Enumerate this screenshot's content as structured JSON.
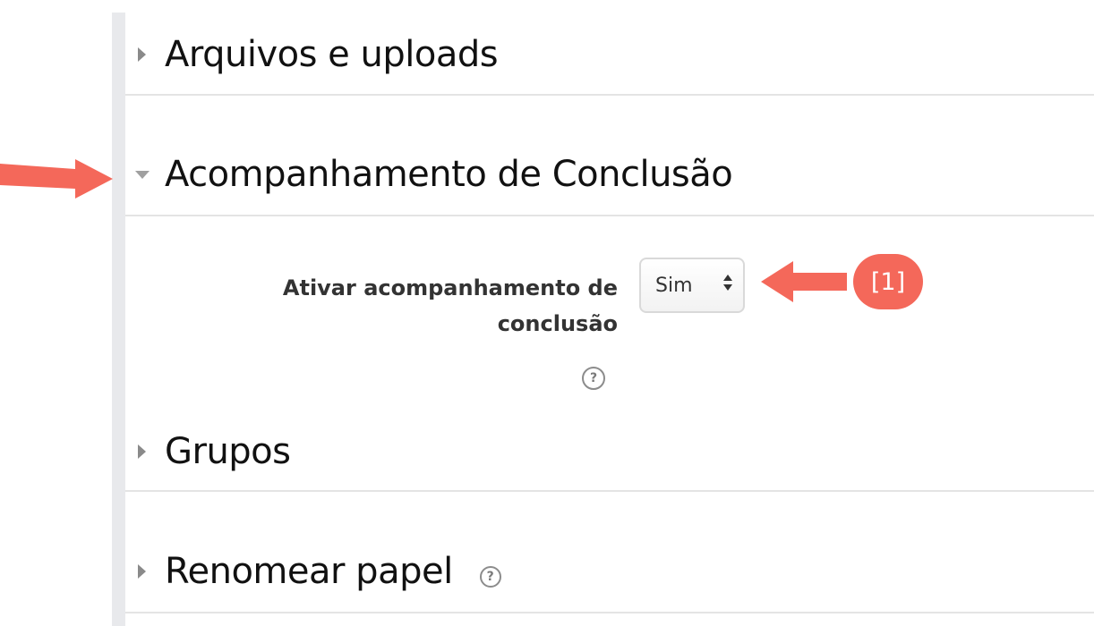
{
  "sections": [
    {
      "title": "Arquivos e uploads",
      "state": "collapsed"
    },
    {
      "title": "Acompanhamento de Conclusão",
      "state": "expanded"
    },
    {
      "title": "Grupos",
      "state": "collapsed"
    },
    {
      "title": "Renomear papel",
      "state": "collapsed"
    }
  ],
  "completion_field": {
    "label_line1": "Ativar acompanhamento de",
    "label_line2": "conclusão",
    "selected_value": "Sim"
  },
  "help_glyph": "?",
  "annotation": {
    "badge_text": "[1]",
    "color": "#f4685a"
  },
  "colors": {
    "accent_annotation": "#f4685a",
    "sidebar_bar": "#e8e9ec",
    "divider": "#e4e4e4"
  }
}
